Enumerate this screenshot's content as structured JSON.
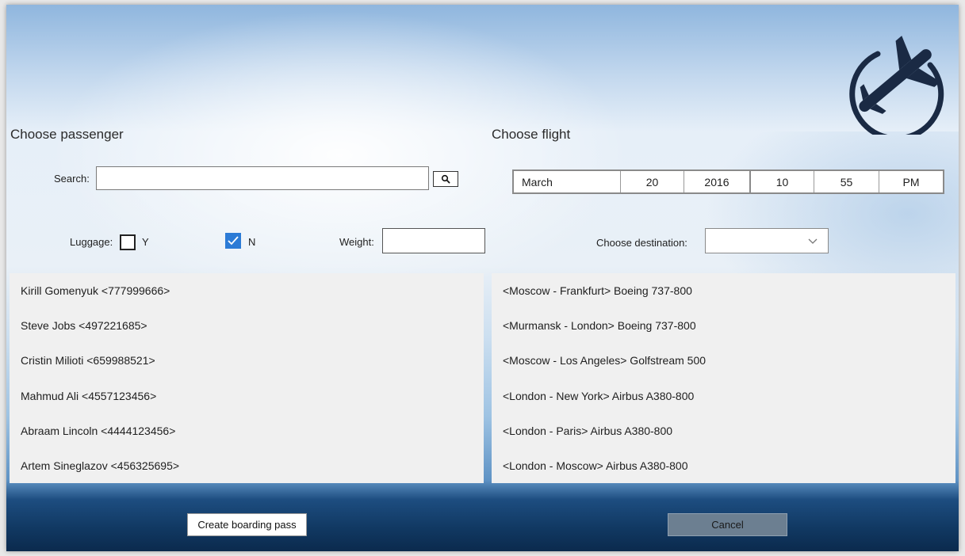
{
  "passenger_section": {
    "heading": "Choose passenger",
    "search_label": "Search:",
    "search_value": "",
    "search_icon": "search-icon",
    "luggage_label": "Luggage:",
    "luggage_yes_label": "Y",
    "luggage_yes_checked": false,
    "luggage_no_label": "N",
    "luggage_no_checked": true,
    "weight_label": "Weight:",
    "weight_value": "",
    "passengers": [
      "Kirill Gomenyuk <777999666>",
      "Steve Jobs <497221685>",
      "Cristin Milioti <659988521>",
      "Mahmud Ali <4557123456>",
      "Abraam Lincoln <4444123456>",
      "Artem Sineglazov <456325695>"
    ]
  },
  "flight_section": {
    "heading": "Choose flight",
    "datetime": {
      "month": "March",
      "day": "20",
      "year": "2016",
      "hour": "10",
      "minute": "55",
      "period": "PM"
    },
    "destination_label": "Choose destination:",
    "destination_value": "",
    "destination_icon": "chevron-down-icon",
    "flights": [
      "<Moscow - Frankfurt>  Boeing 737-800",
      "<Murmansk - London>  Boeing 737-800",
      "<Moscow - Los Angeles>  Golfstream 500",
      "<London - New York>  Airbus A380-800",
      "<London - Paris>  Airbus A380-800",
      "<London - Moscow>  Airbus A380-800"
    ]
  },
  "buttons": {
    "create": "Create boarding pass",
    "cancel": "Cancel"
  },
  "logo_icon": "airplane-logo-icon",
  "colors": {
    "accent": "#2c7bd6",
    "logo": "#1a2a44",
    "cancel_bg": "#6c7f91"
  }
}
